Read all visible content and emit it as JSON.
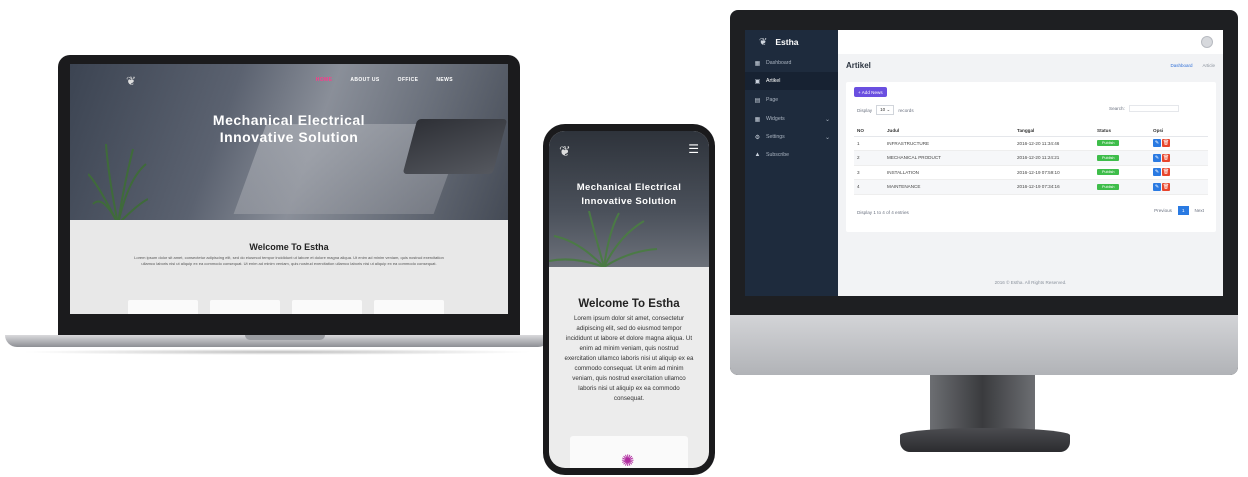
{
  "laptop": {
    "nav": [
      "HOME",
      "ABOUT US",
      "OFFICE",
      "NEWS"
    ],
    "hero_title_line1": "Mechanical Electrical",
    "hero_title_line2": "Innovative Solution",
    "welcome": "Welcome To Estha",
    "lorem": "Lorem ipsum dolor sit amet, consectetur adipiscing elit, sed do eiusmod tempor incididunt ut labore et dolore magna aliqua. Ut enim ad minim veniam, quis nostrud exercitation ullamco laboris nisi ut aliquip ex ea commodo consequat. Ut enim ad minim veniam, quis nostrud exercitation ullamco laboris nisi ut aliquip ex ea commodo consequat."
  },
  "phone": {
    "hero_title_line1": "Mechanical Electrical",
    "hero_title_line2": "Innovative Solution",
    "welcome": "Welcome To Estha",
    "lorem": "Lorem ipsum dolor sit amet, consectetur adipiscing elit, sed do eiusmod tempor incididunt ut labore et dolore magna aliqua. Ut enim ad minim veniam, quis nostrud exercitation ullamco laboris nisi ut aliquip ex ea commodo consequat. Ut enim ad minim veniam, quis nostrud exercitation ullamco laboris nisi ut aliquip ex ea commodo consequat."
  },
  "admin": {
    "brand": "Estha",
    "sidebar": [
      {
        "label": "Dashboard",
        "icon": "dashboard-icon"
      },
      {
        "label": "Artikel",
        "icon": "article-icon"
      },
      {
        "label": "Page",
        "icon": "page-icon"
      },
      {
        "label": "Widgets",
        "icon": "widgets-icon"
      },
      {
        "label": "Settings",
        "icon": "settings-icon"
      },
      {
        "label": "Subscribe",
        "icon": "subscribe-icon"
      }
    ],
    "page_title": "Artikel",
    "breadcrumb": {
      "home": "Dashboard",
      "current": "Article"
    },
    "add_button": "+ Add News",
    "length": {
      "prefix": "Display",
      "value": "10",
      "suffix": "records"
    },
    "search_label": "Search:",
    "columns": [
      "NO",
      "Judul",
      "Tanggal",
      "Status",
      "Opsi"
    ],
    "rows": [
      {
        "no": "1",
        "judul": "INFRASTRUCTURE",
        "tanggal": "2016-12-20 11:34:46",
        "status": "Publish"
      },
      {
        "no": "2",
        "judul": "MECHANICAL PRODUCT",
        "tanggal": "2016-12-20 11:24:21",
        "status": "Publish"
      },
      {
        "no": "3",
        "judul": "INSTALLATION",
        "tanggal": "2016-12-19 07:59:10",
        "status": "Publish"
      },
      {
        "no": "4",
        "judul": "MAINTENANCE",
        "tanggal": "2016-12-19 07:34:16",
        "status": "Publish"
      }
    ],
    "info": "Display 1 to 4 of 4 entries",
    "pager": {
      "prev": "Previous",
      "current": "1",
      "next": "Next"
    },
    "footer": "2016 © Estha. All Rights Reserved.",
    "colors": {
      "sidebar": "#1e2b3d",
      "accent": "#6a4fe0",
      "publish": "#3ebd4a",
      "edit": "#2a7ae2",
      "delete": "#e8452c"
    }
  }
}
